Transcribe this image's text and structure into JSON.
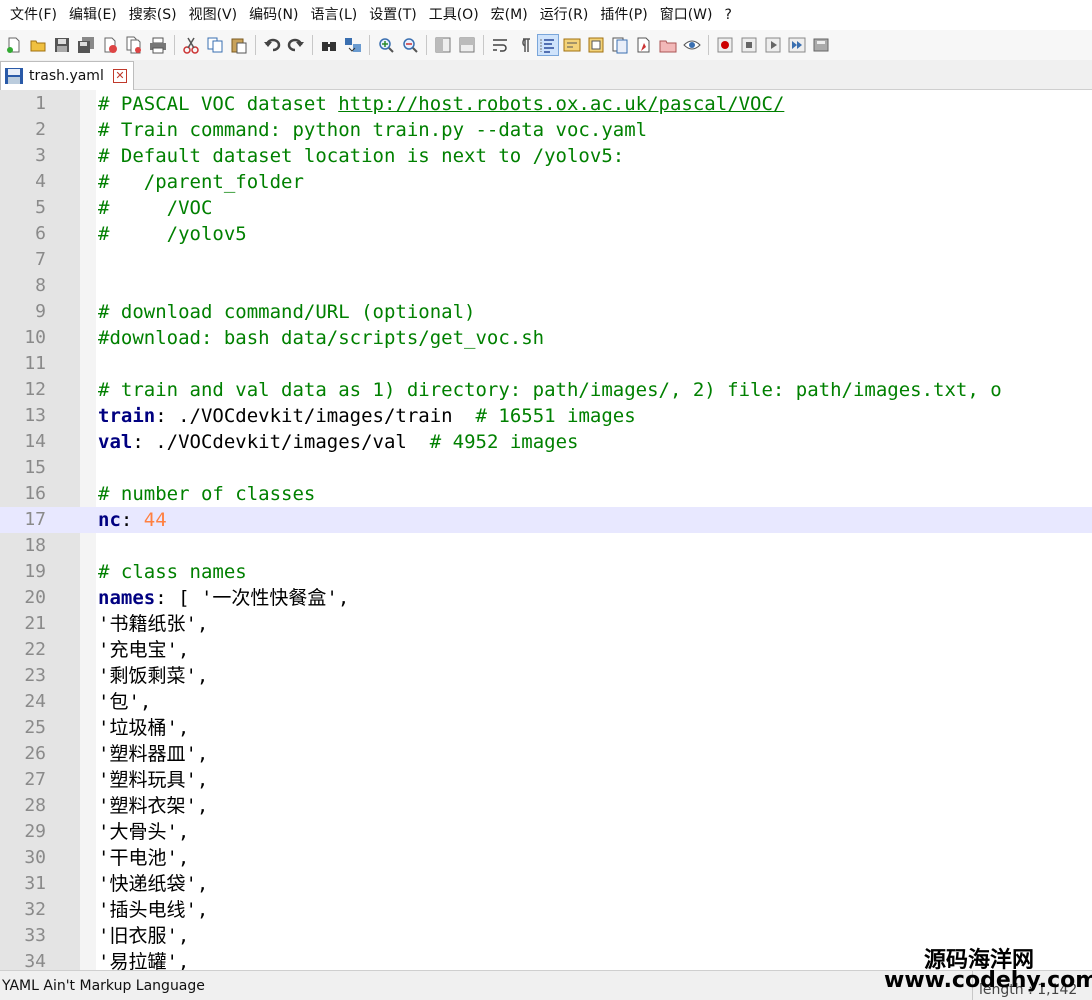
{
  "menu": [
    "文件(F)",
    "编辑(E)",
    "搜索(S)",
    "视图(V)",
    "编码(N)",
    "语言(L)",
    "设置(T)",
    "工具(O)",
    "宏(M)",
    "运行(R)",
    "插件(P)",
    "窗口(W)",
    "?"
  ],
  "tab": {
    "label": "trash.yaml",
    "close_glyph": "✕"
  },
  "lines": [
    {
      "n": "1",
      "parts": [
        {
          "t": "# PASCAL VOC dataset ",
          "c": "com"
        },
        {
          "t": "http://host.robots.ox.ac.uk/pascal/VOC/",
          "c": "url"
        }
      ]
    },
    {
      "n": "2",
      "parts": [
        {
          "t": "# Train command: python train.py --data voc.yaml",
          "c": "com"
        }
      ]
    },
    {
      "n": "3",
      "parts": [
        {
          "t": "# Default dataset location is next to /yolov5:",
          "c": "com"
        }
      ]
    },
    {
      "n": "4",
      "parts": [
        {
          "t": "#   /parent_folder",
          "c": "com"
        }
      ]
    },
    {
      "n": "5",
      "parts": [
        {
          "t": "#     /VOC",
          "c": "com"
        }
      ]
    },
    {
      "n": "6",
      "parts": [
        {
          "t": "#     /yolov5",
          "c": "com"
        }
      ]
    },
    {
      "n": "7",
      "parts": []
    },
    {
      "n": "8",
      "parts": []
    },
    {
      "n": "9",
      "parts": [
        {
          "t": "# download command/URL (optional)",
          "c": "com"
        }
      ]
    },
    {
      "n": "10",
      "parts": [
        {
          "t": "#download: bash data/scripts/get_voc.sh",
          "c": "com"
        }
      ]
    },
    {
      "n": "11",
      "parts": []
    },
    {
      "n": "12",
      "parts": [
        {
          "t": "# train and val data as 1) directory: path/images/, 2) file: path/images.txt, o",
          "c": "com"
        }
      ]
    },
    {
      "n": "13",
      "parts": [
        {
          "t": "train",
          "c": "key"
        },
        {
          "t": ": ./VOCdevkit/images/train  ",
          "c": "str"
        },
        {
          "t": "# 16551 images",
          "c": "com"
        }
      ]
    },
    {
      "n": "14",
      "parts": [
        {
          "t": "val",
          "c": "key"
        },
        {
          "t": ": ./VOCdevkit/images/val  ",
          "c": "str"
        },
        {
          "t": "# 4952 images",
          "c": "com"
        }
      ]
    },
    {
      "n": "15",
      "parts": []
    },
    {
      "n": "16",
      "parts": [
        {
          "t": "# number of classes",
          "c": "com"
        }
      ]
    },
    {
      "n": "17",
      "parts": [
        {
          "t": "nc",
          "c": "key"
        },
        {
          "t": ": ",
          "c": "str"
        },
        {
          "t": "44",
          "c": "num"
        }
      ],
      "current": true
    },
    {
      "n": "18",
      "parts": []
    },
    {
      "n": "19",
      "parts": [
        {
          "t": "# class names",
          "c": "com"
        }
      ]
    },
    {
      "n": "20",
      "parts": [
        {
          "t": "names",
          "c": "key"
        },
        {
          "t": ": [ '一次性快餐盒',",
          "c": "str"
        }
      ]
    },
    {
      "n": "21",
      "parts": [
        {
          "t": "'书籍纸张',",
          "c": "str"
        }
      ]
    },
    {
      "n": "22",
      "parts": [
        {
          "t": "'充电宝',",
          "c": "str"
        }
      ]
    },
    {
      "n": "23",
      "parts": [
        {
          "t": "'剩饭剩菜',",
          "c": "str"
        }
      ]
    },
    {
      "n": "24",
      "parts": [
        {
          "t": "'包',",
          "c": "str"
        }
      ]
    },
    {
      "n": "25",
      "parts": [
        {
          "t": "'垃圾桶',",
          "c": "str"
        }
      ]
    },
    {
      "n": "26",
      "parts": [
        {
          "t": "'塑料器皿',",
          "c": "str"
        }
      ]
    },
    {
      "n": "27",
      "parts": [
        {
          "t": "'塑料玩具',",
          "c": "str"
        }
      ]
    },
    {
      "n": "28",
      "parts": [
        {
          "t": "'塑料衣架',",
          "c": "str"
        }
      ]
    },
    {
      "n": "29",
      "parts": [
        {
          "t": "'大骨头',",
          "c": "str"
        }
      ]
    },
    {
      "n": "30",
      "parts": [
        {
          "t": "'干电池',",
          "c": "str"
        }
      ]
    },
    {
      "n": "31",
      "parts": [
        {
          "t": "'快递纸袋',",
          "c": "str"
        }
      ]
    },
    {
      "n": "32",
      "parts": [
        {
          "t": "'插头电线',",
          "c": "str"
        }
      ]
    },
    {
      "n": "33",
      "parts": [
        {
          "t": "'旧衣服',",
          "c": "str"
        }
      ]
    },
    {
      "n": "34",
      "parts": [
        {
          "t": "'易拉罐',",
          "c": "str"
        }
      ]
    }
  ],
  "status": {
    "language": "YAML Ain't Markup Language",
    "length": "length : 1,142"
  },
  "watermark": {
    "line1": "源码海洋网",
    "line2": "www.codehy.com"
  },
  "toolbar_icons": [
    "new-file-icon",
    "open-file-icon",
    "save-icon",
    "save-all-icon",
    "close-icon",
    "close-all-icon",
    "print-icon",
    "cut-icon",
    "copy-icon",
    "paste-icon",
    "undo-icon",
    "redo-icon",
    "find-icon",
    "replace-icon",
    "zoom-in-icon",
    "zoom-out-icon",
    "sync-vertical-icon",
    "sync-horizontal-icon",
    "word-wrap-icon",
    "show-all-chars-icon",
    "indent-guide-icon",
    "udl-icon",
    "doc-map-icon",
    "function-list-icon",
    "folder-workspace-icon",
    "monitoring-icon",
    "record-macro-icon",
    "stop-record-icon",
    "play-macro-icon",
    "run-macro-multiple-icon",
    "save-macro-icon"
  ],
  "colors": {
    "comment": "#008000",
    "keyword": "#000080",
    "number": "#ff8040",
    "current_line": "#e8e8ff",
    "gutter": "#e4e4e4"
  }
}
